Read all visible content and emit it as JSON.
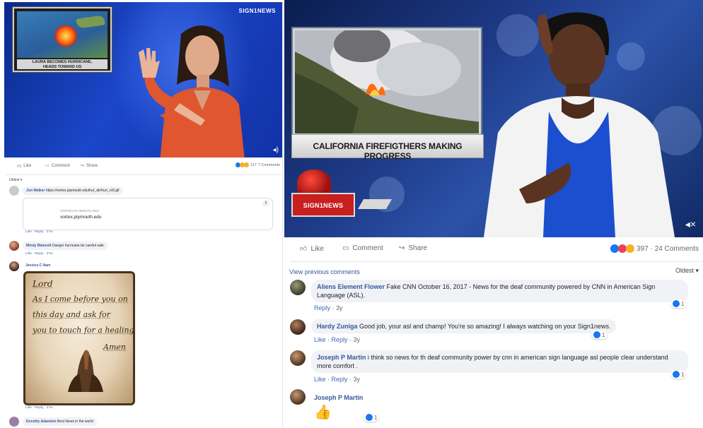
{
  "left": {
    "video": {
      "inset_caption_line1": "LAURA BECOMES HURRICANE,",
      "inset_caption_line2": "HEADS TOWARD US",
      "logo": "SIGN1NEWS"
    },
    "actions": {
      "like": "Like",
      "comment": "Comment",
      "share": "Share"
    },
    "reactions": {
      "count": "117",
      "comments": "7 Comments"
    },
    "oldest": "Oldest ▾",
    "comments": [
      {
        "name": "Jon Walker",
        "text": "https://vortex.plymouth.edu/hur_dir/hurr_nt3.gif",
        "meta": "27w"
      },
      {
        "name": "Mindy Blancett",
        "text": "Danger hurricane be careful safe",
        "meta": "27w"
      },
      {
        "name": "Jessica C Nam",
        "text": "",
        "meta": "27w"
      },
      {
        "name": "Dorothy Adamietz",
        "text": "Best News in the world"
      }
    ],
    "link_card": {
      "domain": "VORTEX.PLYMOUTH.EDU",
      "title": "vortex.plymouth.edu"
    },
    "meta_like": "Like",
    "meta_reply": "Reply",
    "prayer_lines": [
      "Lord",
      "As I come before you on",
      "this day and ask for",
      "you to touch for a healing",
      "Amen"
    ]
  },
  "right": {
    "video": {
      "headline": "CALIFORNIA FIREFIGTHERS MAKING PROGRESS",
      "logo": "SIGN1NEWS"
    },
    "actions": {
      "like": "Like",
      "comment": "Comment",
      "share": "Share"
    },
    "reactions": {
      "count": "397",
      "comments": "· 24 Comments"
    },
    "view_previous": "View previous comments",
    "oldest": "Oldest ▾",
    "comments": [
      {
        "name": "Aliens Element Flower",
        "text": "Fake CNN October 16, 2017 - News for the deaf community powered by CNN in American Sign Language (ASL).",
        "meta_reply": "Reply",
        "meta_time": "3y",
        "likes": "1"
      },
      {
        "name": "Hardy Zuniga",
        "text": "Good job, your asl and champ! You're so amazing! I always watching on your Sign1news.",
        "meta_like": "Like",
        "meta_reply": "Reply",
        "meta_time": "3y",
        "likes": "1"
      },
      {
        "name": "Joseph P Martin",
        "text": "i think so news for th deaf community power by cnn in american sign language asl people clear understand more comfort .",
        "meta_like": "Like",
        "meta_reply": "Reply",
        "meta_time": "3y",
        "likes": "1"
      },
      {
        "name": "Joseph P Martin",
        "text": "👍",
        "likes": "1"
      }
    ]
  },
  "colors": {
    "link": "#385898",
    "bubble": "#f0f2f5",
    "like_blue": "#1877f2",
    "love_red": "#f33e58"
  }
}
